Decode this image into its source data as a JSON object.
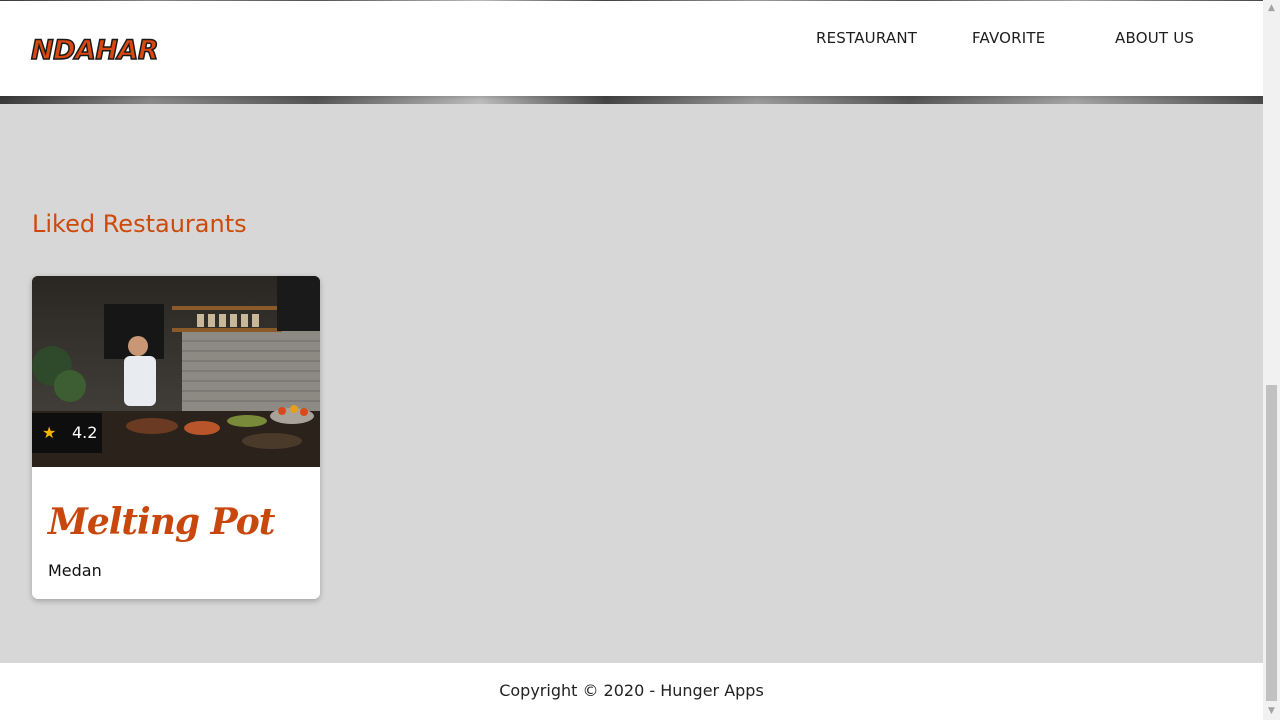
{
  "header": {
    "logo": "NDAHAR",
    "nav": [
      "RESTAURANT",
      "FAVORITE",
      "ABOUT US"
    ]
  },
  "main": {
    "section_title": "Liked Restaurants",
    "restaurants": [
      {
        "name": "Melting Pot",
        "city": "Medan",
        "rating": "4.2"
      }
    ]
  },
  "footer": {
    "copyright": "Copyright © 2020 - Hunger Apps"
  },
  "colors": {
    "accent": "#cc4a0c",
    "rating_star": "#f5b400",
    "background": "#d7d7d7"
  },
  "icons": {
    "rating": "star-icon"
  }
}
